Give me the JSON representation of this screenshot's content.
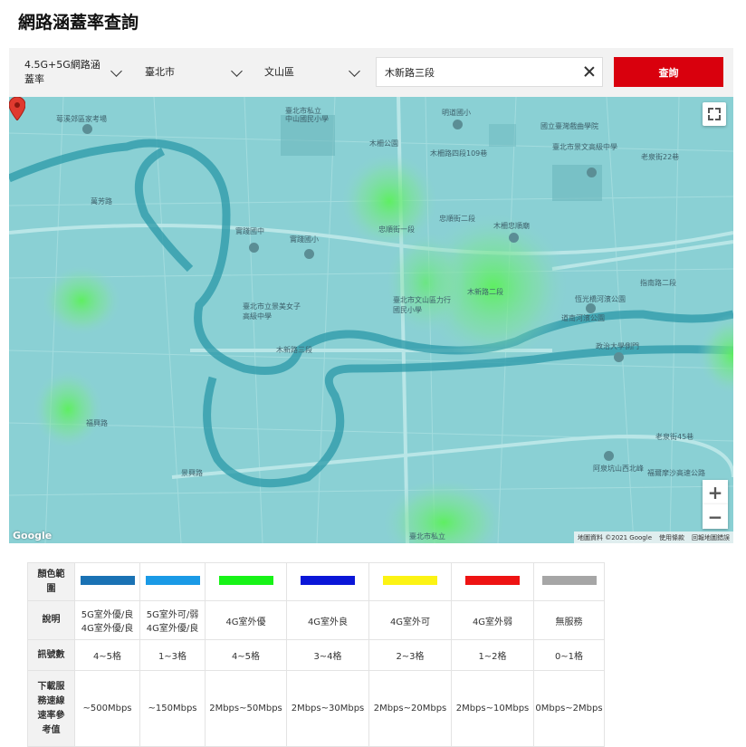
{
  "page": {
    "title": "網路涵蓋率查詢"
  },
  "filters": {
    "network_type": "4.5G+5G網路涵蓋率",
    "city": "臺北市",
    "district": "文山區",
    "address_value": "木新路三段",
    "search_label": "查詢"
  },
  "map": {
    "attribution": "地圖資料 ©2021 Google",
    "terms": "使用條款",
    "report": "回報地圖錯誤",
    "logo": "Google",
    "zoom_in": "+",
    "zoom_out": "−",
    "labels": {
      "l1": "萼溪郊區家考場",
      "l2": "臺北市私立",
      "l3": "中山國民小學",
      "l4": "明道國小",
      "l5": "國立臺灣戲曲學院",
      "l6": "木柵公園",
      "l7": "臺北市景文高級中學",
      "l8": "木柵路四段109巷",
      "l9": "實踐國中",
      "l10": "實踐國小",
      "l11": "忠順街一段",
      "l12": "忠順街二段",
      "l13": "木柵忠順廟",
      "l14": "臺北市立景美女子高級中學",
      "l15": "臺北市文山區力行國民小學",
      "l16": "木新路三段",
      "l17": "木新路二段",
      "l18": "恆光橋河濱公園",
      "l19": "道南河濱公園",
      "l20": "政治大學側門",
      "l21": "福興路",
      "l22": "萬芳路",
      "l23": "阿泉坑山西北峰",
      "l24": "福爾摩沙高速公路",
      "l25": "景興路",
      "l26": "指南路二段",
      "l27": "臺北市私立",
      "l28": "老泉街45巷",
      "l29": "老泉街22巷"
    }
  },
  "legend": {
    "headers": {
      "color": "顏色範圍",
      "desc": "說明",
      "signal": "訊號數",
      "speed": "下載服務速線速率參考值"
    },
    "colors": [
      "#1a72b4",
      "#1a9ae6",
      "#17f317",
      "#0a16d8",
      "#fcf314",
      "#ee1313",
      "#a6a6a6"
    ],
    "desc": [
      {
        "line1": "5G室外優/良",
        "line2": "4G室外優/良"
      },
      {
        "line1": "5G室外可/弱",
        "line2": "4G室外優/良"
      },
      {
        "line1": "4G室外優",
        "line2": ""
      },
      {
        "line1": "4G室外良",
        "line2": ""
      },
      {
        "line1": "4G室外可",
        "line2": ""
      },
      {
        "line1": "4G室外弱",
        "line2": ""
      },
      {
        "line1": "無服務",
        "line2": ""
      }
    ],
    "signal": [
      "4~5格",
      "1~3格",
      "4~5格",
      "3~4格",
      "2~3格",
      "1~2格",
      "0~1格"
    ],
    "speed": [
      "~500Mbps",
      "~150Mbps",
      "2Mbps~50Mbps",
      "2Mbps~30Mbps",
      "2Mbps~20Mbps",
      "2Mbps~10Mbps",
      "0Mbps~2Mbps"
    ]
  }
}
